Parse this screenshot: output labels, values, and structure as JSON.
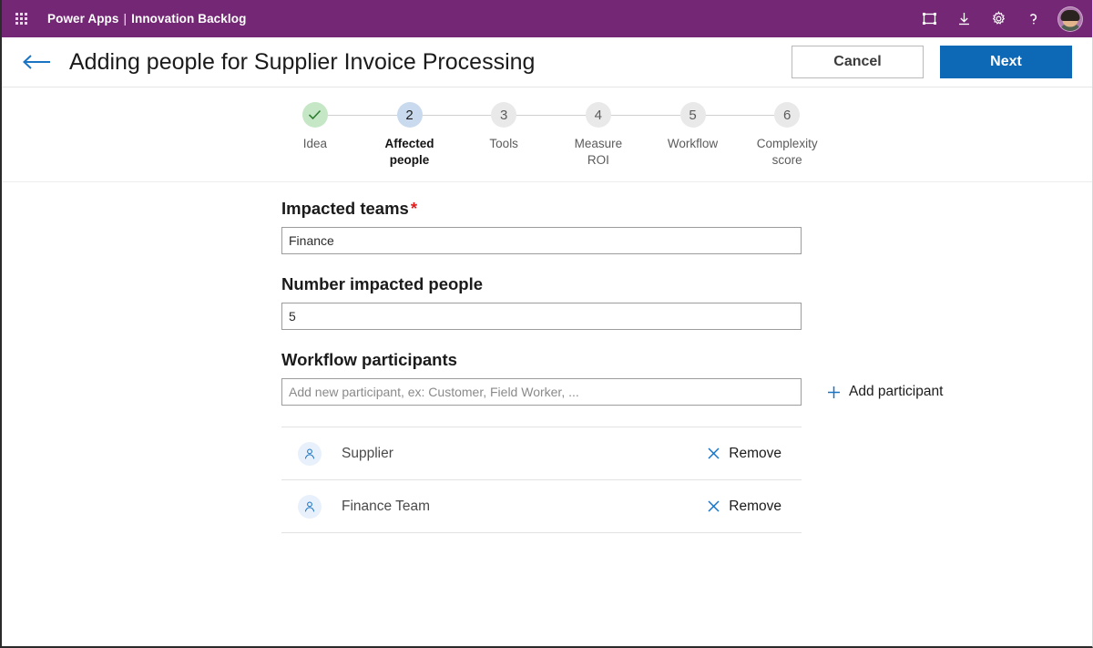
{
  "topbar": {
    "waffle_label": "app-launcher",
    "brand_primary": "Power Apps",
    "brand_separator": "|",
    "brand_secondary": "Innovation Backlog",
    "icons": [
      {
        "name": "fit-to-screen-icon",
        "label": "Fit to screen"
      },
      {
        "name": "download-icon",
        "label": "Download"
      },
      {
        "name": "gear-icon",
        "label": "Settings"
      },
      {
        "name": "help-icon",
        "label": "Help"
      }
    ],
    "avatar_label": "User account"
  },
  "command_bar": {
    "back_label": "Back",
    "title": "Adding people for Supplier Invoice Processing",
    "cancel_label": "Cancel",
    "next_label": "Next"
  },
  "stepper": {
    "current_step": 2,
    "steps": [
      {
        "number": "1",
        "label": "Idea",
        "state": "done",
        "glyph": "check"
      },
      {
        "number": "2",
        "label": "Affected\npeople",
        "state": "current",
        "glyph": "2"
      },
      {
        "number": "3",
        "label": "Tools",
        "state": "upcoming",
        "glyph": "3"
      },
      {
        "number": "4",
        "label": "Measure\nROI",
        "state": "upcoming",
        "glyph": "4"
      },
      {
        "number": "5",
        "label": "Workflow",
        "state": "upcoming",
        "glyph": "5"
      },
      {
        "number": "6",
        "label": "Complexity\nscore",
        "state": "upcoming",
        "glyph": "6"
      }
    ]
  },
  "form": {
    "impacted_teams": {
      "label": "Impacted teams",
      "required_mark": "*",
      "value": "Finance",
      "placeholder": ""
    },
    "number_impacted_people": {
      "label": "Number impacted people",
      "value": "5",
      "placeholder": ""
    },
    "workflow_participants": {
      "label": "Workflow participants",
      "input_value": "",
      "input_placeholder": "Add new participant, ex: Customer, Field Worker, ...",
      "add_label": "Add participant",
      "remove_label": "Remove",
      "items": [
        {
          "name": "Supplier"
        },
        {
          "name": "Finance Team"
        }
      ]
    }
  },
  "colors": {
    "brand_purple": "#742774",
    "primary_blue": "#0d68b5",
    "link_blue": "#1a74c4",
    "step_done_bg": "#c6e7c6",
    "step_current_bg": "#c9daee",
    "step_upcoming_bg": "#e9e9e9",
    "required_red": "#e31c1c"
  }
}
